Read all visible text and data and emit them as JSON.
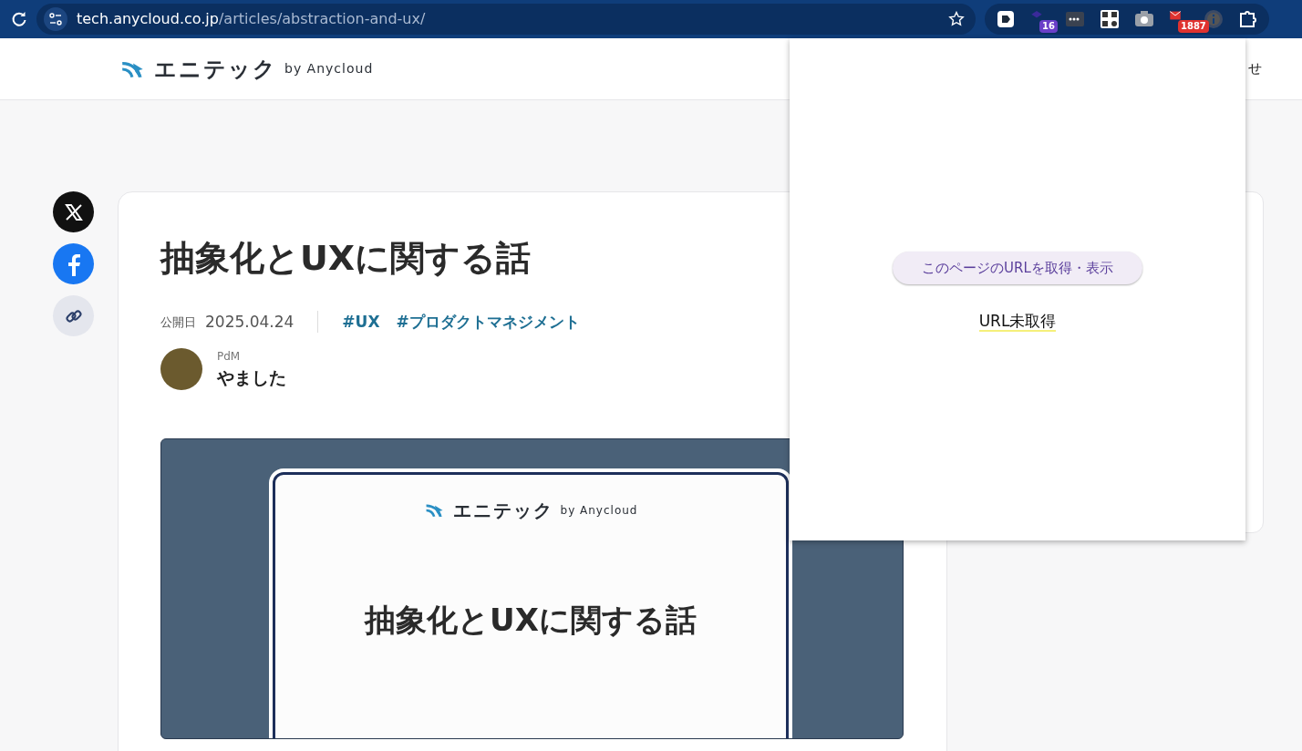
{
  "browser": {
    "url_host": "tech.anycloud.co.jp",
    "url_path": "/articles/abstraction-and-ux/",
    "extension_badges": [
      {
        "text": "16",
        "color": "#6a3fc8"
      },
      {
        "text": "1887",
        "color": "#e0322f"
      }
    ]
  },
  "site_header": {
    "logo_text": "エニテック",
    "logo_suffix": "by Anycloud",
    "nav_fragment": "せ"
  },
  "article": {
    "title": "抽象化とUXに関する話",
    "published_label": "公開日",
    "date": "2025.04.24",
    "tags": [
      "#UX",
      "#プロダクトマネジメント"
    ],
    "author_role": "PdM",
    "author_name": "やました",
    "hero": {
      "logo_text": "エニテック",
      "logo_suffix": "by Anycloud",
      "title": "抽象化とUXに関する話"
    }
  },
  "popup": {
    "button_label": "このページのURLを取得・表示",
    "status": "URL未取得"
  }
}
